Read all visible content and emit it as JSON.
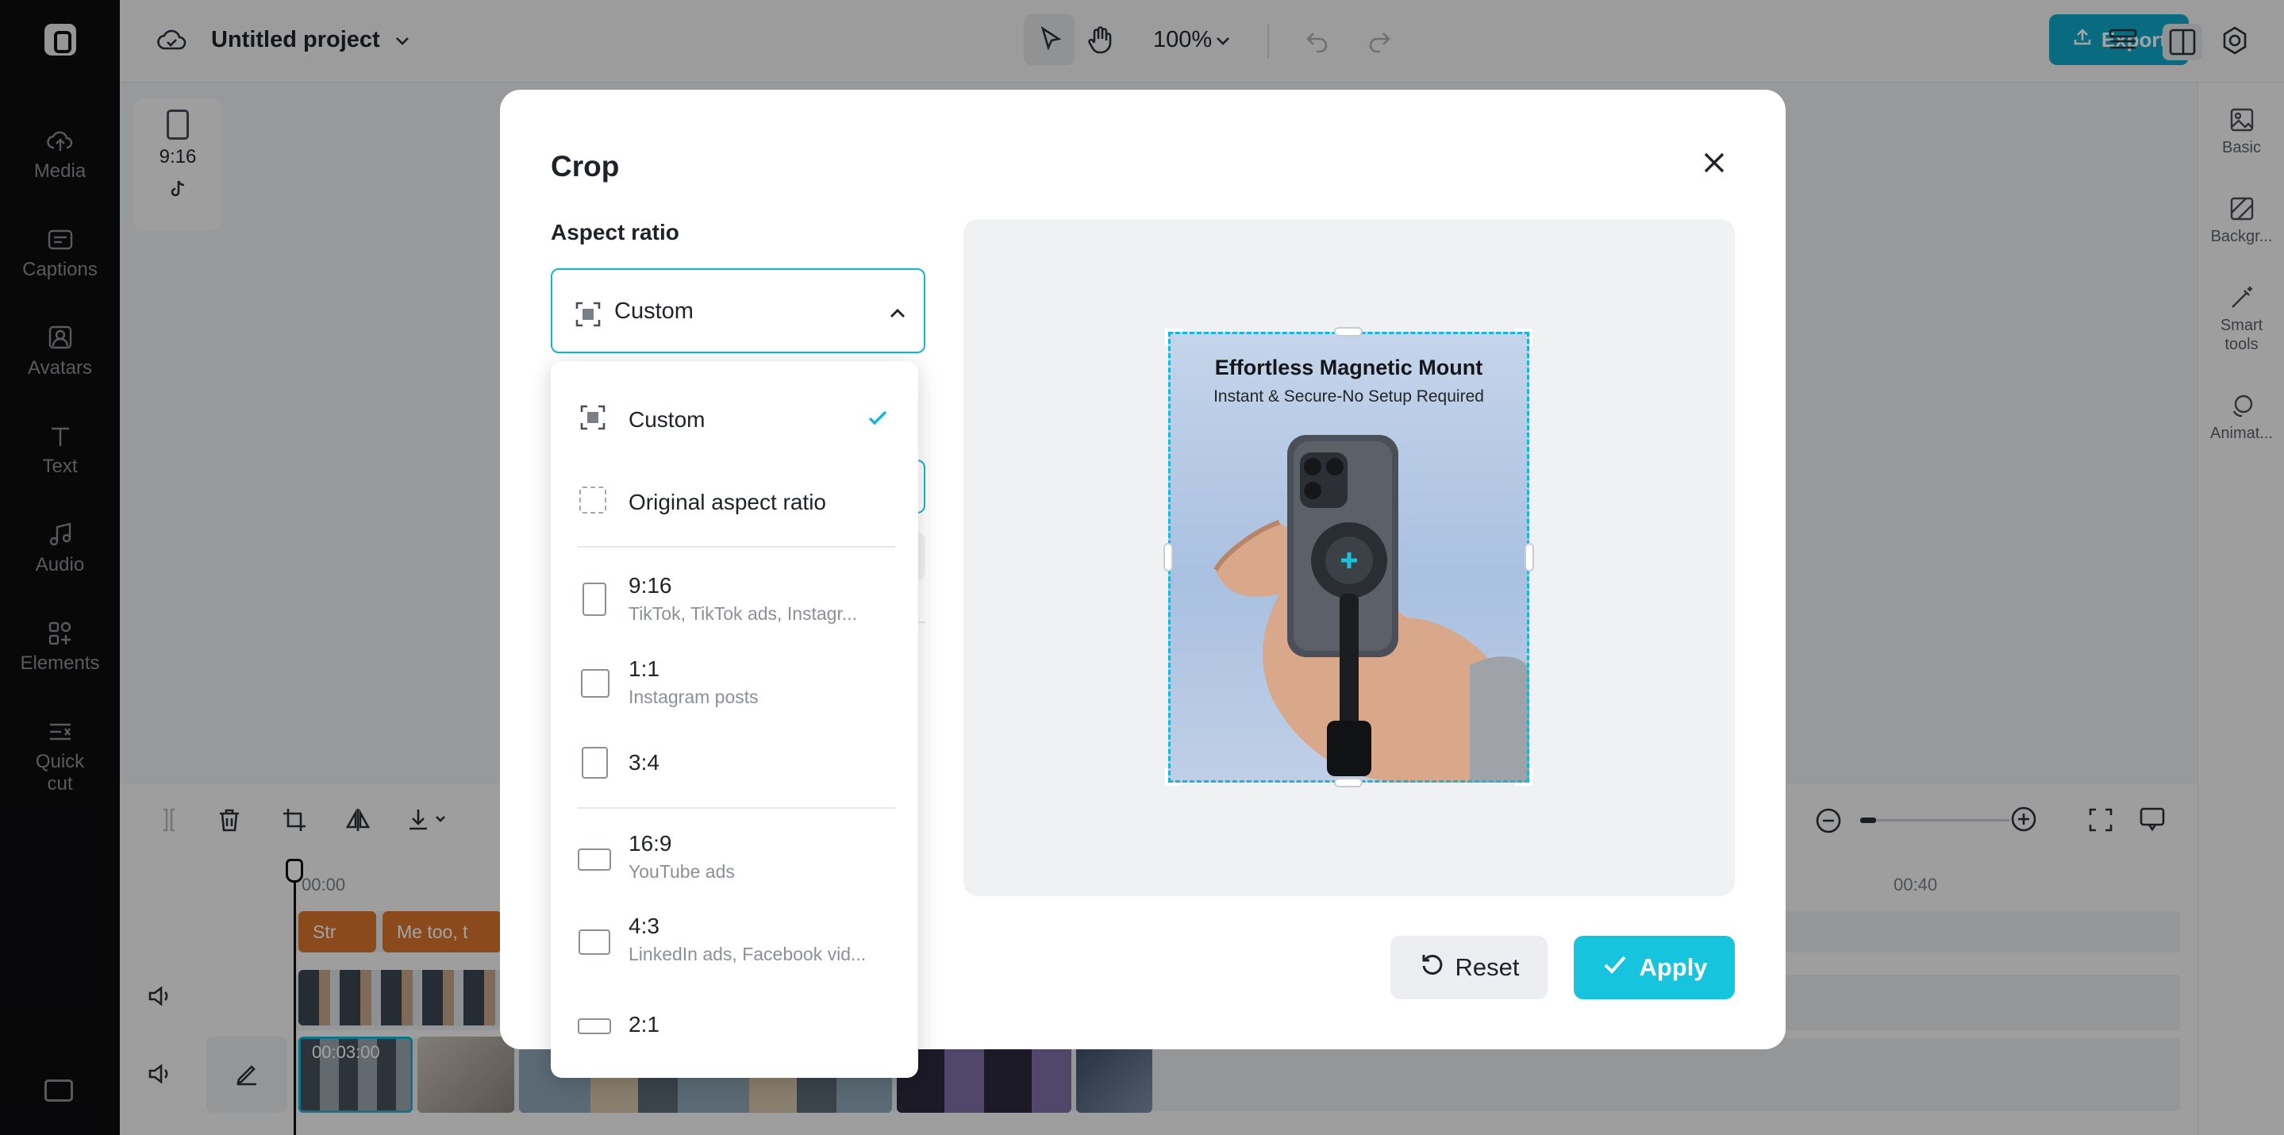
{
  "app": {
    "project_title": "Untitled project",
    "zoom_level": "100%",
    "export_label": "Export"
  },
  "sidebar": {
    "items": [
      {
        "label": "Media",
        "icon": "cloud-upload-icon"
      },
      {
        "label": "Captions",
        "icon": "captions-icon"
      },
      {
        "label": "Avatars",
        "icon": "avatar-icon"
      },
      {
        "label": "Text",
        "icon": "text-icon"
      },
      {
        "label": "Audio",
        "icon": "music-note-icon"
      },
      {
        "label": "Elements",
        "icon": "elements-icon"
      },
      {
        "label": "Quick cut",
        "icon": "quick-cut-icon"
      }
    ]
  },
  "canvas": {
    "ratio_chip": "9:16"
  },
  "right_panel": {
    "items": [
      {
        "label": "Basic",
        "icon": "image-icon"
      },
      {
        "label": "Backgr...",
        "icon": "background-icon"
      },
      {
        "label": "Smart tools",
        "icon": "magic-wand-icon"
      },
      {
        "label": "Animat...",
        "icon": "animation-icon"
      }
    ]
  },
  "timeline": {
    "ruler_start": "00:00",
    "ruler_end": "00:40",
    "clip_time": "00:03:00",
    "text_clips": [
      "Str",
      "Me too, t"
    ]
  },
  "modal": {
    "title": "Crop",
    "aspect_ratio_label": "Aspect ratio",
    "selected_value": "Custom",
    "preview": {
      "headline": "Effortless Magnetic Mount",
      "subline": "Instant & Secure-No Setup Required"
    },
    "reset_label": "Reset",
    "apply_label": "Apply",
    "accent_color": "#17c4dd"
  },
  "dropdown": {
    "options": [
      {
        "label": "Custom",
        "sub": "",
        "selected": true
      },
      {
        "label": "Original aspect ratio",
        "sub": "",
        "selected": false
      },
      {
        "label": "9:16",
        "sub": "TikTok, TikTok ads, Instagr...",
        "selected": false
      },
      {
        "label": "1:1",
        "sub": "Instagram posts",
        "selected": false
      },
      {
        "label": "3:4",
        "sub": "",
        "selected": false
      },
      {
        "label": "16:9",
        "sub": "YouTube ads",
        "selected": false
      },
      {
        "label": "4:3",
        "sub": "LinkedIn ads, Facebook vid...",
        "selected": false
      },
      {
        "label": "2:1",
        "sub": "",
        "selected": false
      }
    ]
  }
}
